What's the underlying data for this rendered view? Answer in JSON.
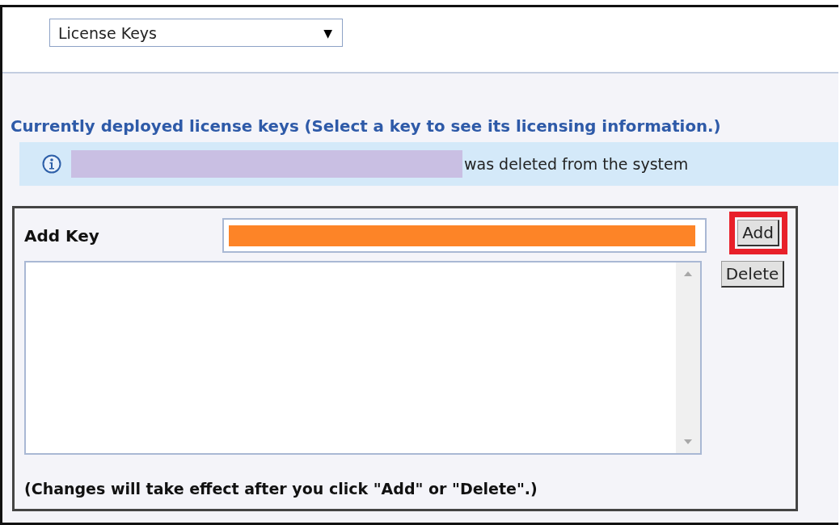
{
  "page_selector": {
    "value": "License Keys",
    "caret": "▼"
  },
  "heading": "Currently deployed license keys (Select a key to see its licensing information.)",
  "notice": {
    "kind": "info",
    "redacted": true,
    "message": "was deleted from the system"
  },
  "add_key": {
    "label": "Add Key",
    "value_redacted": true,
    "buttons": [
      {
        "label": "Add",
        "highlighted": true
      },
      {
        "label": "Delete",
        "highlighted": false
      }
    ],
    "note": "(Changes will take effect after you click \"Add\" or \"Delete\".)"
  }
}
